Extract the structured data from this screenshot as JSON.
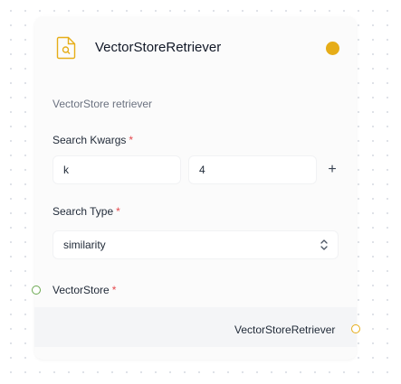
{
  "node": {
    "title": "VectorStoreRetriever",
    "description": "VectorStore retriever",
    "icon": "file-search-icon",
    "status_color": "#e6ad18"
  },
  "fields": {
    "search_kwargs": {
      "label": "Search Kwargs",
      "required_mark": "*",
      "key": "k",
      "value": "4",
      "add_label": "+"
    },
    "search_type": {
      "label": "Search Type",
      "required_mark": "*",
      "value": "similarity",
      "icon": "chevron-up-down-icon"
    }
  },
  "handles": {
    "input": {
      "label": "VectorStore",
      "required_mark": "*",
      "color": "#6aa84f"
    },
    "output": {
      "label": "VectorStoreRetriever",
      "color": "#e6ad18"
    }
  }
}
